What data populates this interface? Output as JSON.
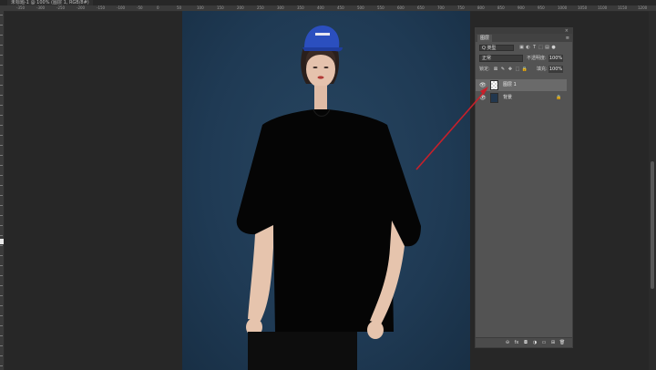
{
  "document": {
    "tab_title": "未标题-1 @ 100% (图层 1, RGB/8#)"
  },
  "ruler": {
    "ticks": [
      "-350",
      "-300",
      "-250",
      "-200",
      "-150",
      "-100",
      "-50",
      "0",
      "50",
      "100",
      "150",
      "200",
      "250",
      "300",
      "350",
      "400",
      "450",
      "500",
      "550",
      "600",
      "650",
      "700",
      "750",
      "800",
      "850",
      "900",
      "950",
      "1000",
      "1050",
      "1100",
      "1150",
      "1200"
    ]
  },
  "layers_panel": {
    "tab_label": "图层",
    "close_label": "×",
    "menu_label": "≡",
    "filter": {
      "label": "Q 类型"
    },
    "filter_icons": [
      "▣",
      "◐",
      "T",
      "⬚",
      "▤",
      "●"
    ],
    "blend_mode": "正常",
    "opacity_label": "不透明度:",
    "opacity_value": "100%",
    "lock_label": "锁定:",
    "lock_icons": [
      "⊠",
      "✎",
      "✥",
      "⬚",
      "🔒"
    ],
    "fill_label": "填充:",
    "fill_value": "100%",
    "layers": [
      {
        "name": "图层 1",
        "visible": true,
        "selected": true
      },
      {
        "name": "背景",
        "visible": true,
        "selected": false,
        "locked": true
      }
    ],
    "footer_icons": [
      "⊖",
      "fx",
      "◘",
      "◑",
      "▭",
      "⊞",
      "🗑"
    ]
  },
  "colors": {
    "background": "#272727",
    "panel": "#535353",
    "canvas_bg": "#1f3a54",
    "annotation_arrow": "#c8202a"
  }
}
